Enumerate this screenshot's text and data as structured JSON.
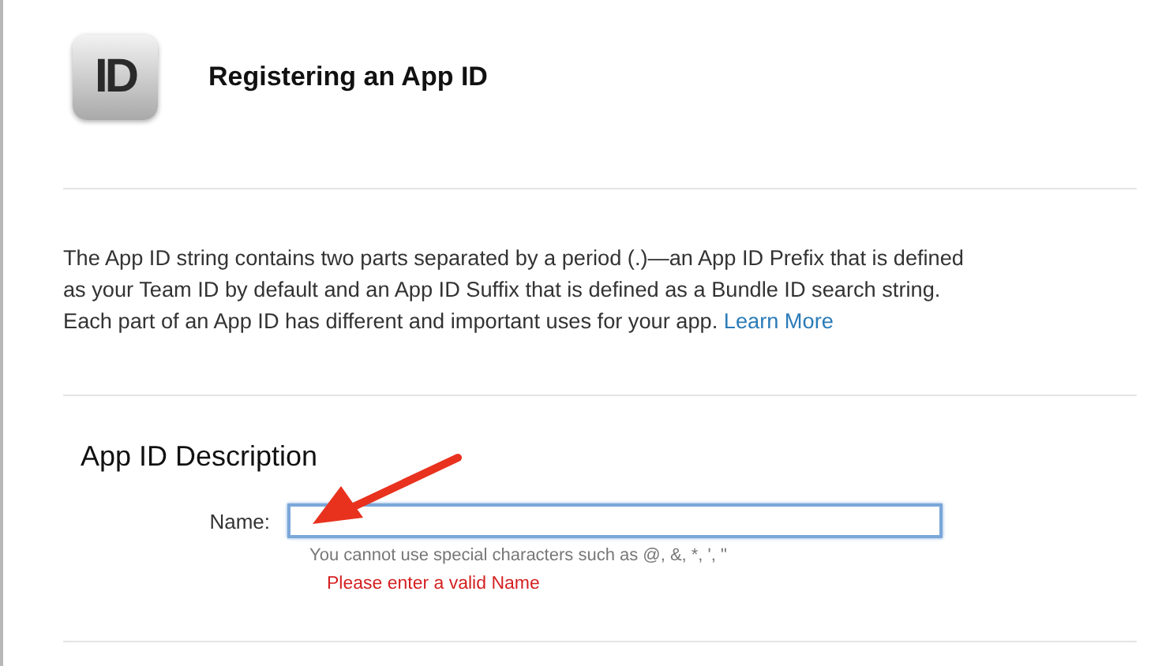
{
  "header": {
    "icon_text": "ID",
    "title": "Registering an App ID"
  },
  "intro": {
    "lines": [
      "The App ID string contains two parts separated by a period (.)—an App ID Prefix that is defined",
      "as your Team ID by default and an App ID Suffix that is defined as a Bundle ID search string.",
      "Each part of an App ID has different and important uses for your app."
    ],
    "link": "Learn More"
  },
  "section": {
    "title": "App ID Description",
    "fields": [
      {
        "label": "Name:",
        "focused": true,
        "hint": "You cannot use special characters such as @, &, *, ', \"",
        "error": "Please enter a valid Name"
      }
    ]
  },
  "annotation": {
    "kind": "arrow"
  }
}
